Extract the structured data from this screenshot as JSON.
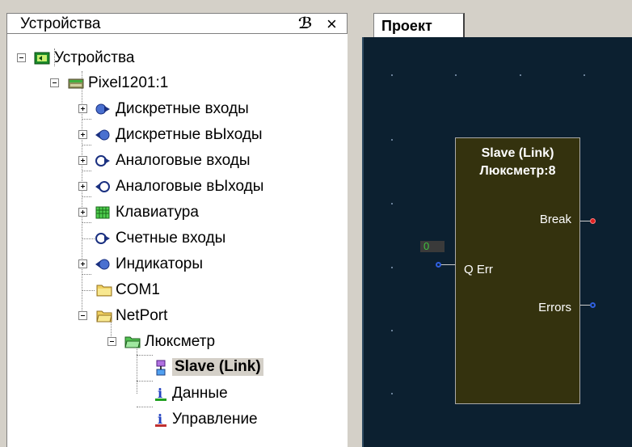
{
  "devices_panel": {
    "title": "Устройства",
    "pin_glyph": "ℬ",
    "close_glyph": "×",
    "tree": {
      "root": "Устройства",
      "device": "Pixel1201:1",
      "items": [
        "Дискретные входы",
        "Дискретные вЫходы",
        "Аналоговые входы",
        "Аналоговые вЫходы",
        "Клавиатура",
        "Счетные входы",
        "Индикаторы",
        "COM1",
        "NetPort"
      ],
      "netport_child": "Люксметр",
      "luxmeter_children": [
        "Slave (Link)",
        "Данные",
        "Управление"
      ]
    }
  },
  "project": {
    "tab_label": "Проект",
    "block": {
      "title_line1": "Slave (Link)",
      "title_line2": "Люксметр:8",
      "input_port": "Q Err",
      "input_value": "0",
      "output_break": "Break",
      "output_errors": "Errors"
    }
  },
  "colors": {
    "canvas_bg": "#0c2030",
    "block_bg": "#34320e",
    "break_pin": "#e02020",
    "blue_pin": "#3060e0",
    "value_text": "#3fc13f"
  }
}
